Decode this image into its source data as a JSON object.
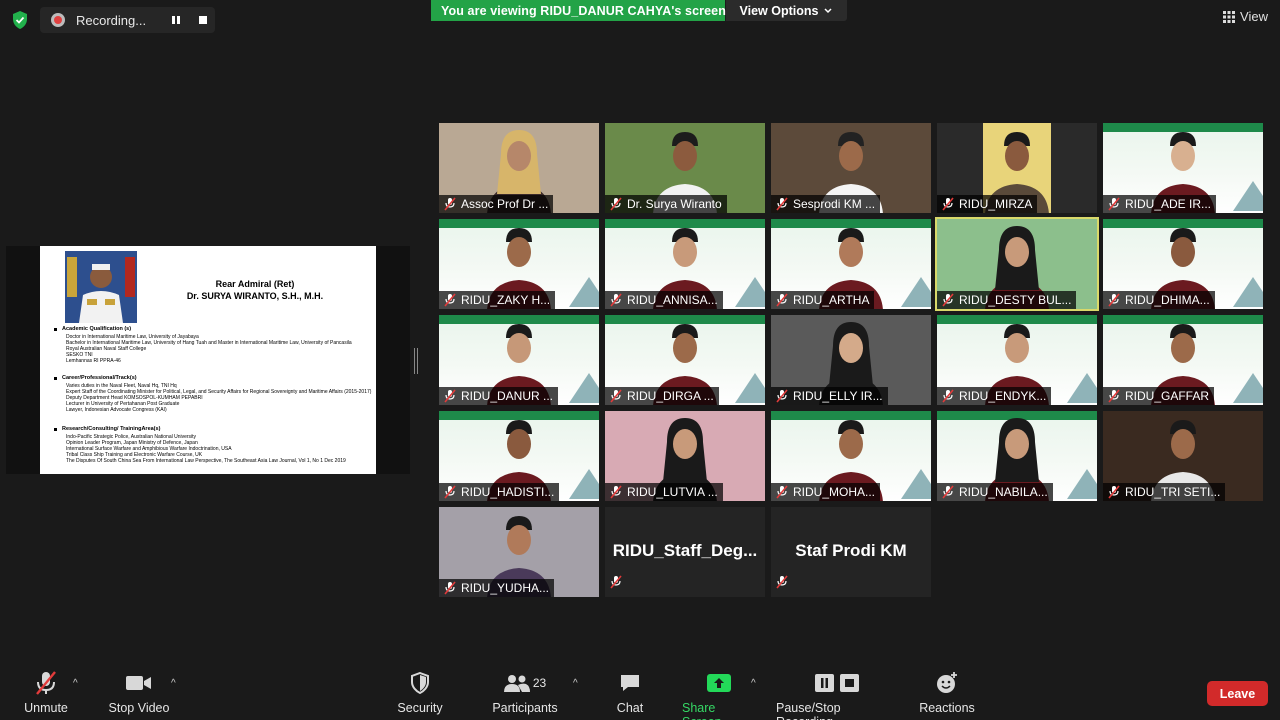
{
  "recording": {
    "label": "Recording..."
  },
  "banner": {
    "viewing_text": "You are viewing RIDU_DANUR CAHYA's screen",
    "view_options": "View Options"
  },
  "view_button": "View",
  "slide": {
    "title_line1": "Rear Admiral (Ret)",
    "title_line2": "Dr. SURYA WIRANTO, S.H., M.H.",
    "sections": [
      {
        "heading": "Academic Qualification (s)",
        "lines": [
          "Doctor in International Maritime Law, University of Jayabaya",
          "Bachelor in International Maritime Law, University of Hang Tuah and Master in International Maritime Law, University of Pancasila",
          "Royal Australian Naval Staff College",
          "SESKO TNI",
          "Lemhannas RI PPRA-46"
        ]
      },
      {
        "heading": "Career/Professional/Track(s)",
        "lines": [
          "Varies duties in the Naval Fleet, Naval Hq, TNI Hq",
          "Expert Staff of the Coordinating Minister for Political, Legal, and Security Affairs for Regional Sovereignty and Maritime Affairs (2015-2017)",
          "Deputy Department Head KOMSOSPOL-KUMHAM PEPABRI",
          "Lecturer in University of Pertahanan Post Graduate",
          "Lawyer, Indonesian Advocate Congress (KAI)"
        ]
      },
      {
        "heading": "Research/Consulting/ TrainingArea(s)",
        "lines": [
          "Indo-Pacific Strategic Police, Australian National University",
          "Opinion Leader Program, Japan Ministry of Defence, Japan",
          "International Surface Warfare and Amphibious Warfare Indoctrination, USA",
          "Tribal Class Ship Training and Electronic Warfare Course, UK",
          "The Disputes Of South China Sea From International Law Perspective, The Southeast Asia Law Journal, Vol 1, No 1 Dec 2019"
        ]
      }
    ]
  },
  "participants": [
    {
      "name": "Assoc Prof Dr ..."
    },
    {
      "name": "Dr. Surya Wiranto"
    },
    {
      "name": "Sesprodi KM ..."
    },
    {
      "name": "RIDU_MIRZA"
    },
    {
      "name": "RIDU_ADE IR..."
    },
    {
      "name": "RIDU_ZAKY H..."
    },
    {
      "name": "RIDU_ANNISA..."
    },
    {
      "name": "RIDU_ARTHA"
    },
    {
      "name": "RIDU_DESTY BUL..."
    },
    {
      "name": "RIDU_DHIMA..."
    },
    {
      "name": "RIDU_DANUR ..."
    },
    {
      "name": "RIDU_DIRGA ..."
    },
    {
      "name": "RIDU_ELLY IR..."
    },
    {
      "name": "RIDU_ENDYK..."
    },
    {
      "name": "RIDU_GAFFAR"
    },
    {
      "name": "RIDU_HADISTI..."
    },
    {
      "name": "RIDU_LUTVIA ..."
    },
    {
      "name": "RIDU_MOHA..."
    },
    {
      "name": "RIDU_NABILA..."
    },
    {
      "name": "RIDU_TRI SETI..."
    },
    {
      "name": "RIDU_YUDHA..."
    },
    {
      "name": "RIDU_Staff_Deg..."
    },
    {
      "name": "Staf Prodi KM"
    }
  ],
  "toolbar": {
    "unmute": "Unmute",
    "stop_video": "Stop Video",
    "security": "Security",
    "participants": "Participants",
    "participants_count": "23",
    "chat": "Chat",
    "share_screen": "Share Screen",
    "pause_stop_recording": "Pause/Stop Recording",
    "reactions": "Reactions",
    "leave": "Leave"
  },
  "colors": {
    "banner_green": "#23a347",
    "leave_red": "#d22a2a",
    "share_green": "#23d959",
    "active_speaker": "#d9d96a"
  }
}
